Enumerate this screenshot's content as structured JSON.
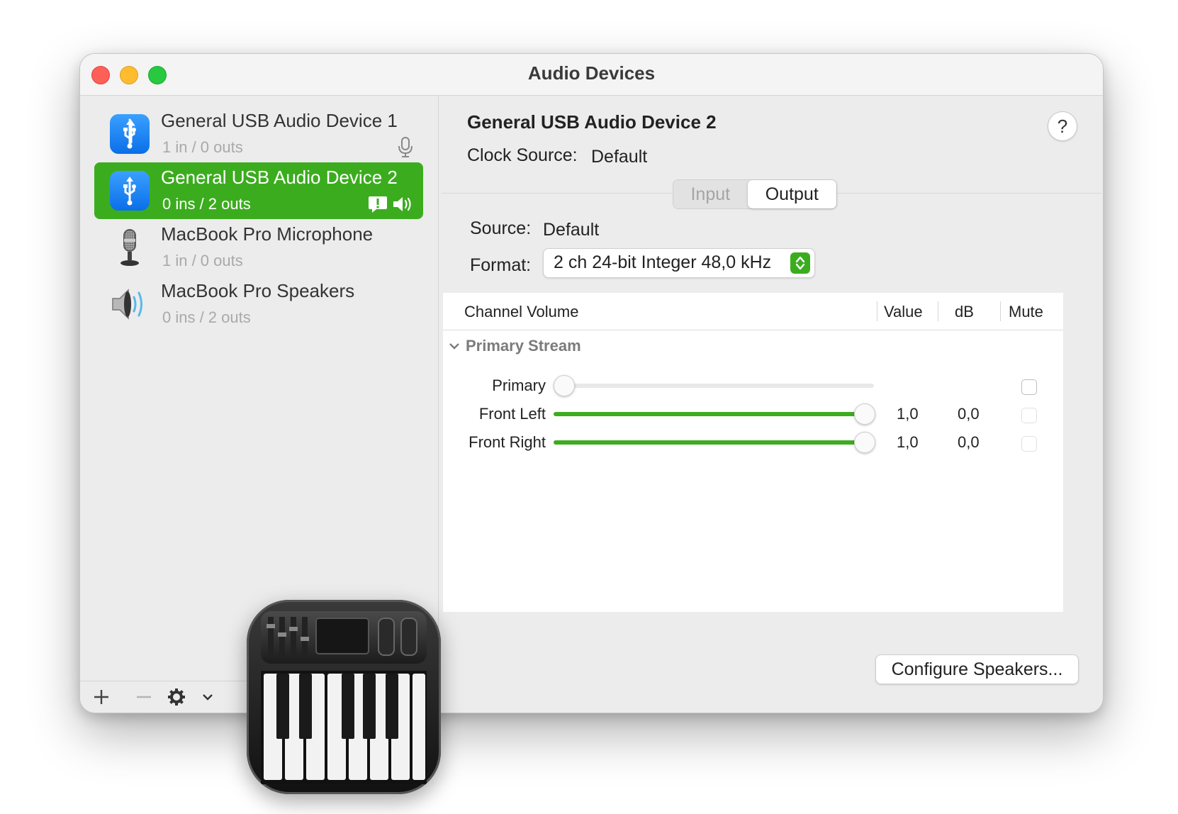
{
  "window": {
    "title": "Audio Devices"
  },
  "sidebar": {
    "devices": [
      {
        "name": "General USB Audio Device 1",
        "channels": "1 in / 0 outs",
        "icon": "usb-icon",
        "status_icons": [
          "microphone-icon"
        ],
        "selected": false
      },
      {
        "name": "General USB Audio Device 2",
        "channels": "0 ins / 2 outs",
        "icon": "usb-icon",
        "status_icons": [
          "alert-bubble-icon",
          "speaker-icon"
        ],
        "selected": true
      },
      {
        "name": "MacBook Pro Microphone",
        "channels": "1 in / 0 outs",
        "icon": "microphone-device-icon",
        "status_icons": [],
        "selected": false
      },
      {
        "name": "MacBook Pro Speakers",
        "channels": "0 ins / 2 outs",
        "icon": "speaker-device-icon",
        "status_icons": [],
        "selected": false
      }
    ],
    "toolbar": {
      "add_icon": "plus-icon",
      "remove_icon": "minus-icon",
      "settings_icon": "gear-icon",
      "menu_icon": "chevron-down-icon"
    }
  },
  "detail": {
    "device_title": "General USB Audio Device 2",
    "clock_source_label": "Clock Source:",
    "clock_source_value": "Default",
    "help_label": "?",
    "tabs": [
      {
        "label": "Input",
        "active": false
      },
      {
        "label": "Output",
        "active": true
      }
    ],
    "source_label": "Source:",
    "source_value": "Default",
    "format_label": "Format:",
    "format_value": "2 ch 24-bit Integer 48,0 kHz",
    "table": {
      "headers": {
        "channel": "Channel Volume",
        "value": "Value",
        "db": "dB",
        "mute": "Mute"
      },
      "group": "Primary Stream",
      "rows": [
        {
          "label": "Primary",
          "level": 0.0,
          "value": "",
          "db": "",
          "mute": false,
          "enabled": true
        },
        {
          "label": "Front Left",
          "level": 1.0,
          "value": "1,0",
          "db": "0,0",
          "mute": false,
          "enabled": false
        },
        {
          "label": "Front Right",
          "level": 1.0,
          "value": "1,0",
          "db": "0,0",
          "mute": false,
          "enabled": false
        }
      ]
    },
    "configure_button": "Configure Speakers..."
  },
  "colors": {
    "accent_green": "#3cac1f",
    "usb_blue": "#0a7cff",
    "close": "#fe5f57",
    "minimize": "#febc2e",
    "zoom": "#28c840"
  },
  "app_icon": "audio-midi-setup-app-icon"
}
